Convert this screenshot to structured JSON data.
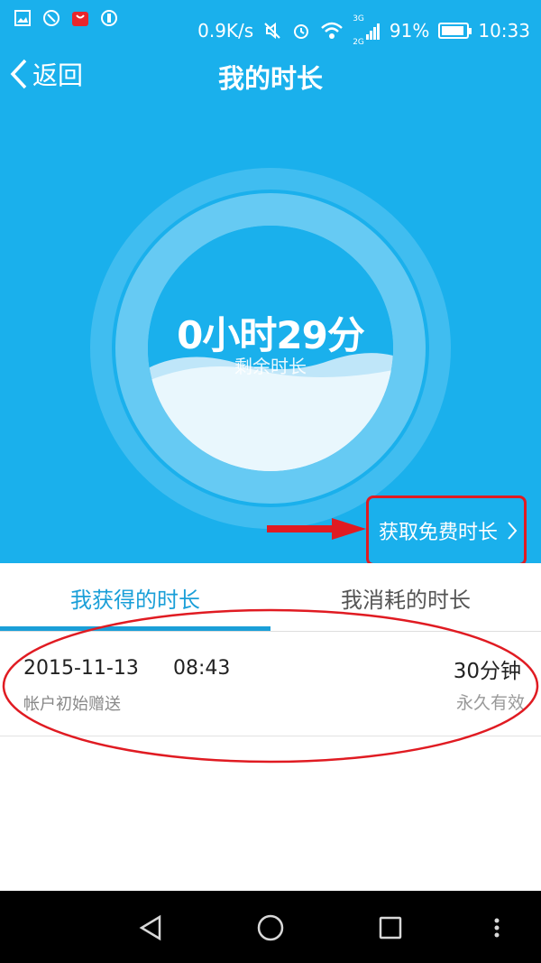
{
  "status_bar": {
    "network_speed": "0.9K/s",
    "signal_3g": "3G",
    "signal_2g": "2G",
    "battery_percent": "91%",
    "battery_level": 0.91,
    "time": "10:33",
    "icons": [
      "image-icon",
      "app-icon",
      "shop-icon",
      "notification-icon",
      "mute-icon",
      "alarm-icon",
      "wifi-icon",
      "signal-icon",
      "battery-icon"
    ]
  },
  "nav": {
    "back_label": "返回",
    "title": "我的时长"
  },
  "summary": {
    "remaining_time": "0小时29分",
    "remaining_label": "剩余时长",
    "get_free_label": "获取免费时长"
  },
  "tabs": [
    {
      "label": "我获得的时长",
      "active": true
    },
    {
      "label": "我消耗的时长",
      "active": false
    }
  ],
  "records": [
    {
      "date": "2015-11-13",
      "time": "08:43",
      "source": "帐户初始赠送",
      "amount": "30分钟",
      "validity": "永久有效"
    }
  ],
  "colors": {
    "primary": "#1ab0ec",
    "tab_active": "#1a9fd8",
    "annotation_red": "#e01b22"
  }
}
